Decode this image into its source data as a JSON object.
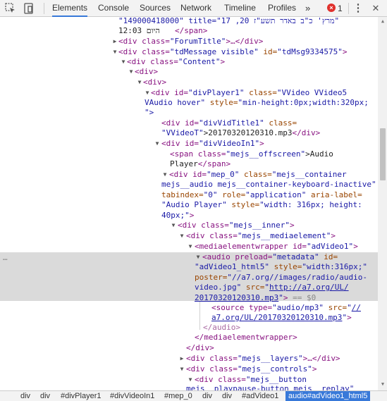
{
  "toolbar": {
    "tabs": [
      "Elements",
      "Console",
      "Sources",
      "Network",
      "Timeline",
      "Profiles"
    ],
    "more_label": "»",
    "error_count": "1",
    "active_tab": "Elements"
  },
  "tree": {
    "l0": "\"149000418000\" title=\"17 ,20 מרץ' כ\"ב באדר תשע\"ז\"",
    "l1a": "12:03 היום",
    "l1b": "</span>",
    "l2_tag": "<div class=",
    "l2_val": "\"ForumTitle\"",
    "l2_close": ">…</div>",
    "l3_tag": "<div class=",
    "l3_val": "\"tdMessage visible\"",
    "l3_attr": " id=",
    "l3_val2": "\"tdMsg9334575\"",
    "l3_close": ">",
    "l4_tag": "<div class=",
    "l4_val": "\"Content\"",
    "l4_close": ">",
    "l5": "<div>",
    "l6": "<div>",
    "l7_tag": "<div id=",
    "l7_val": "\"divPlayer1\"",
    "l7_attr": " class=",
    "l7_val2": "\"VVideo VVideo5",
    "l8_val": "VAudio hover\"",
    "l8_attr": " style=",
    "l8_val2": "\"min-height:0px;width:320px;",
    "l9": "\">",
    "l10_tag": "<div id=",
    "l10_val": "\"divVidTitle1\"",
    "l10_attr": " class=",
    "l11_val": "\"VVideoT\"",
    "l11_txt": ">20170320120310.mp3",
    "l11_close": "</div>",
    "l12_tag": "<div id=",
    "l12_val": "\"divVideoIn1\"",
    "l12_close": ">",
    "l13_tag": "<span class=",
    "l13_val": "\"mejs__offscreen\"",
    "l13_txt": ">Audio",
    "l14_txt": "Player",
    "l14_close": "</span>",
    "l15_tag": "<div id=",
    "l15_val": "\"mep_0\"",
    "l15_attr": " class=",
    "l15_val2": "\"mejs__container",
    "l16_val": "mejs__audio mejs__container-keyboard-inactive\"",
    "l17_attr": "tabindex=",
    "l17_val": "\"0\"",
    "l17_attr2": " role=",
    "l17_val2": "\"application\"",
    "l17_attr3": " aria-label=",
    "l18_val": "\"Audio Player\"",
    "l18_attr": " style=",
    "l18_val2": "\"width: 316px; height:",
    "l19_val": "40px;\"",
    "l19_close": ">",
    "l20_tag": "<div class=",
    "l20_val": "\"mejs__inner\"",
    "l20_close": ">",
    "l21_tag": "<div class=",
    "l21_val": "\"mejs__mediaelement\"",
    "l21_close": ">",
    "l22_tag": "<mediaelementwrapper id=",
    "l22_val": "\"adVideo1\"",
    "l22_close": ">",
    "l23_tag": "<audio preload=",
    "l23_val": "\"metadata\"",
    "l23_attr": " id=",
    "l24_val": "\"adVideo1_html5\"",
    "l24_attr": " style=",
    "l24_val2": "\"width:316px;\"",
    "l25_attr": "poster=",
    "l25_val": "\"//a7.org//images/radio/audio-",
    "l26_val": "video.jpg\"",
    "l26_attr": " src=",
    "l26_q": "\"",
    "l26_link": "http://a7.org/UL/",
    "l27_link": "20170320120310.mp3",
    "l27_q": "\"",
    "l27_close": ">",
    "l27_eq": " == $0",
    "l28_tag": "<source type=",
    "l28_val": "\"audio/mp3\"",
    "l28_attr": " src=",
    "l28_q": "\"",
    "l28_link": "//",
    "l29_link": "a7.org/UL/20170320120310.mp3",
    "l29_q": "\"",
    "l29_close": ">",
    "l30": "</audio>",
    "l31": "</mediaelementwrapper>",
    "l32": "</div>",
    "l33_tag": "<div class=",
    "l33_val": "\"mejs__layers\"",
    "l33_close": ">…</div>",
    "l34_tag": "<div class=",
    "l34_val": "\"mejs__controls\"",
    "l34_close": ">",
    "l35_tag": "<div class=",
    "l35_val": "\"mejs__button",
    "l36_val": "mejs__playpause-button mejs__replay\"",
    "dots": "…"
  },
  "breadcrumbs": [
    "div",
    "div",
    "#divPlayer1",
    "#divVideoIn1",
    "#mep_0",
    "div",
    "div",
    "#adVideo1",
    "audio#adVideo1_html5"
  ]
}
